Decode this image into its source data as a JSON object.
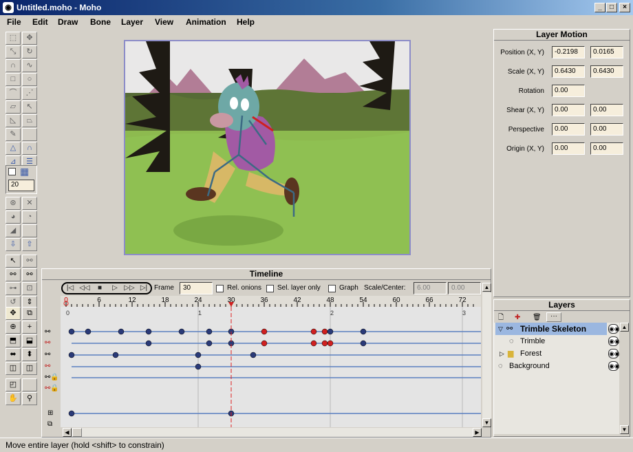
{
  "window": {
    "title": "Untitled.moho - Moho",
    "controls": [
      "_",
      "□",
      "×"
    ]
  },
  "menu": [
    "File",
    "Edit",
    "Draw",
    "Bone",
    "Layer",
    "View",
    "Animation",
    "Help"
  ],
  "toolbox": {
    "width_value": "20"
  },
  "layer_motion": {
    "title": "Layer Motion",
    "rows": [
      {
        "label": "Position (X, Y)",
        "v1": "-0.2198",
        "v2": "0.0165"
      },
      {
        "label": "Scale (X, Y)",
        "v1": "0.6430",
        "v2": "0.6430"
      },
      {
        "label": "Rotation",
        "v1": "0.00",
        "v2": null
      },
      {
        "label": "Shear (X, Y)",
        "v1": "0.00",
        "v2": "0.00"
      },
      {
        "label": "Perspective",
        "v1": "0.00",
        "v2": "0.00"
      },
      {
        "label": "Origin (X, Y)",
        "v1": "0.00",
        "v2": "0.00"
      }
    ]
  },
  "timeline": {
    "title": "Timeline",
    "transport": [
      "|◁",
      "◁◁",
      "■",
      "▷",
      "▷▷",
      "▷|"
    ],
    "frame_label": "Frame",
    "frame_value": "30",
    "rel_onions": "Rel. onions",
    "sel_layer_only": "Sel. layer only",
    "graph": "Graph",
    "scale_center": "Scale/Center:",
    "scale_value": "6.00",
    "center_value": "0.00",
    "ruler_labels": [
      "0",
      "6",
      "12",
      "18",
      "24",
      "30",
      "36",
      "42",
      "48",
      "54",
      "60",
      "66",
      "72"
    ],
    "second_labels": [
      "0",
      "1",
      "2",
      "3"
    ],
    "current_frame": 30,
    "channels": [
      {
        "keys": [
          1,
          4,
          10,
          15,
          21,
          26,
          30,
          36,
          45,
          47,
          48,
          54
        ],
        "red": [
          36,
          45,
          47
        ]
      },
      {
        "keys": [
          15,
          26,
          30,
          36,
          45,
          47,
          48,
          54
        ],
        "red": [
          36,
          45,
          47,
          48
        ]
      },
      {
        "keys": [
          1,
          9,
          24,
          34
        ],
        "red": []
      },
      {
        "keys": [
          24
        ],
        "red": []
      },
      {
        "keys": [],
        "red": []
      },
      {
        "keys": [
          1,
          30
        ],
        "red": []
      }
    ]
  },
  "layers": {
    "title": "Layers",
    "items": [
      {
        "name": "Trimble Skeleton",
        "selected": true
      },
      {
        "name": "Trimble",
        "selected": false
      },
      {
        "name": "Forest",
        "selected": false
      },
      {
        "name": "Background",
        "selected": false
      }
    ]
  },
  "status": "Move entire layer (hold <shift> to constrain)"
}
